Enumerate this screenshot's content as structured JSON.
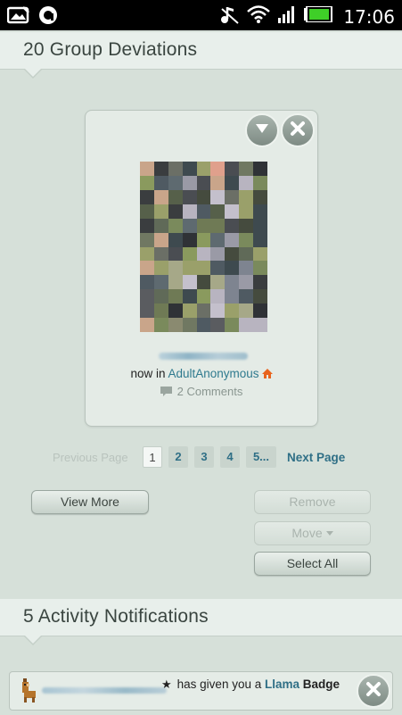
{
  "status_bar": {
    "clock": "17:06",
    "icons": [
      "image-icon",
      "app-icon",
      "music-muted-icon",
      "wifi-icon",
      "signal-icon",
      "battery-icon"
    ]
  },
  "deviations_section": {
    "title": "20 Group Deviations"
  },
  "deviation_card": {
    "now_in_prefix": "now in ",
    "group_name": "AdultAnonymous",
    "comments": "2 Comments",
    "menu_button_icon": "chevron-down-icon",
    "close_button_icon": "close-icon"
  },
  "pagination": {
    "previous": "Previous Page",
    "pages": [
      "1",
      "2",
      "3",
      "4",
      "5..."
    ],
    "current_page": "1",
    "next": "Next Page"
  },
  "actions": {
    "view_more": "View More",
    "remove": "Remove",
    "move": "Move",
    "select_all": "Select All"
  },
  "notifications_section": {
    "title": "5 Activity Notifications"
  },
  "notification": {
    "message": "has given you a",
    "link": "Llama",
    "badge": "Badge",
    "icon": "llama-icon"
  },
  "colors": {
    "background": "#d6e0d9",
    "link": "#2f6f86",
    "group_home_icon": "#e8641e"
  }
}
